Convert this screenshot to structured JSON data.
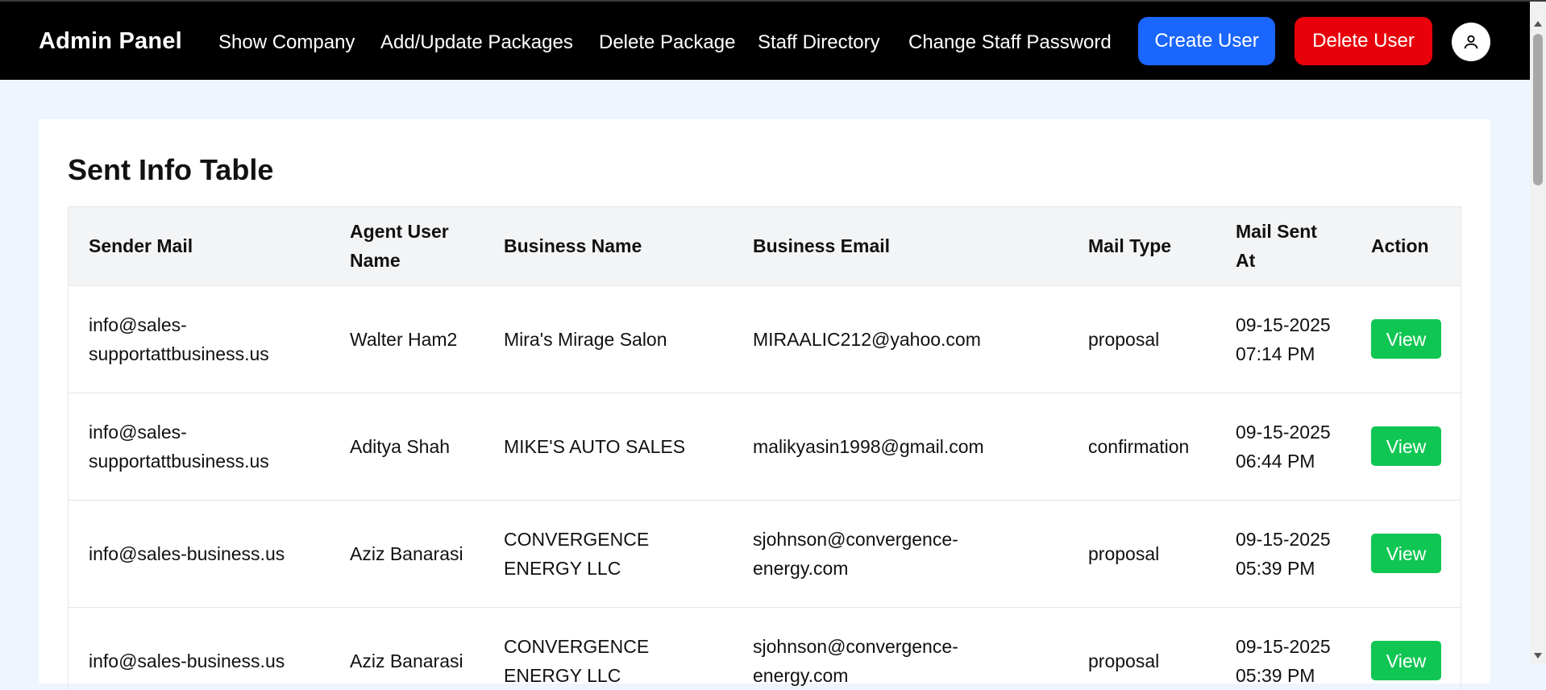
{
  "navbar": {
    "brand": "Admin Panel",
    "links": [
      "Show Company",
      "Add/Update Packages",
      "Delete Package",
      "Staff Directory",
      "Change Staff Password"
    ],
    "create_user": "Create User",
    "delete_user": "Delete User",
    "avatar_icon": "user-icon"
  },
  "colors": {
    "navbar_bg": "#000000",
    "create_user": "#1a66ff",
    "delete_user": "#e8000a",
    "view_button": "#10c653",
    "page_bg": "#eef5ff"
  },
  "page": {
    "title": "Sent Info Table"
  },
  "table": {
    "headers": [
      "Sender Mail",
      "Agent User Name",
      "Business Name",
      "Business Email",
      "Mail Type",
      "Mail Sent At",
      "Action"
    ],
    "rows": [
      {
        "sender": "info@sales-supportattbusiness.us",
        "agent": "Walter Ham2",
        "business": "Mira's Mirage Salon",
        "email": "MIRAALIC212@yahoo.com",
        "type": "proposal",
        "sent_at": "09-15-2025 07:14 PM",
        "action": "View"
      },
      {
        "sender": "info@sales-supportattbusiness.us",
        "agent": "Aditya Shah",
        "business": "MIKE'S AUTO SALES",
        "email": "malikyasin1998@gmail.com",
        "type": "confirmation",
        "sent_at": "09-15-2025 06:44 PM",
        "action": "View"
      },
      {
        "sender": "info@sales-business.us",
        "agent": "Aziz Banarasi",
        "business": "CONVERGENCE ENERGY LLC",
        "email": "sjohnson@convergence-energy.com",
        "type": "proposal",
        "sent_at": "09-15-2025 05:39 PM",
        "action": "View"
      },
      {
        "sender": "info@sales-business.us",
        "agent": "Aziz Banarasi",
        "business": "CONVERGENCE ENERGY LLC",
        "email": "sjohnson@convergence-energy.com",
        "type": "proposal",
        "sent_at": "09-15-2025 05:39 PM",
        "action": "View"
      }
    ]
  }
}
